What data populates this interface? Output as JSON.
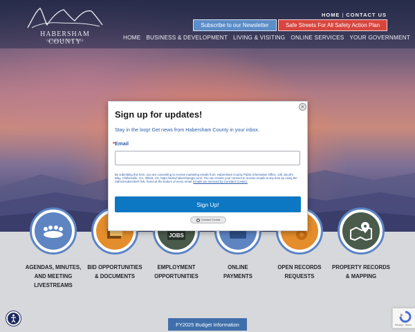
{
  "header": {
    "logo": {
      "title": "HABERSHAM COUNTY",
      "subtitle": "GEORGIA | Est. 1818"
    },
    "top_links": [
      "HOME",
      "CONTACT US"
    ],
    "newsletter_button": "Subscribe to our Newsletter",
    "safety_button": "Safe Streets For All Safety Action Plan",
    "nav": [
      "HOME",
      "BUSINESS & DEVELOPMENT",
      "LIVING & VISITING",
      "ONLINE SERVICES",
      "YOUR GOVERNMENT"
    ]
  },
  "modal": {
    "close_icon": "close-icon",
    "title": "Sign up for updates!",
    "intro": "Stay in the loop! Get news from Habersham County in your inbox.",
    "required_marker": "*",
    "email_label": "Email",
    "email_value": "",
    "consent_text": "By submitting this form, you are consenting to receive marketing emails from: Habersham County Public Information Office, 130 Jacob's Way, Clarkesville, GA, 30523, US, https://www.habershamga.com/. You can revoke your consent to receive emails at any time by using the SafeUnsubscribe® link, found at the bottom of every email.",
    "consent_link": "Emails are serviced by Constant Contact.",
    "signup_button": "Sign Up!",
    "badge_text": "Constant Contact"
  },
  "services": [
    {
      "label_1": "AGENDAS, MINUTES,",
      "label_2": "AND MEETING",
      "label_3": "LIVESTREAMS",
      "icon": "meeting-table-icon"
    },
    {
      "label_1": "BID OPPORTUNITIES",
      "label_2": "& DOCUMENTS",
      "label_3": "",
      "icon": "documents-icon"
    },
    {
      "label_1": "EMPLOYMENT",
      "label_2": "OPPORTUNITIES",
      "label_3": "",
      "icon": "jobs-icon",
      "icon_text": "JOBS"
    },
    {
      "label_1": "ONLINE",
      "label_2": "PAYMENTS",
      "label_3": "",
      "icon": "payment-card-icon"
    },
    {
      "label_1": "OPEN RECORDS",
      "label_2": "REQUESTS",
      "label_3": "",
      "icon": "gear-icon"
    },
    {
      "label_1": "PROPERTY RECORDS",
      "label_2": "& MAPPING",
      "label_3": "",
      "icon": "map-pin-icon"
    }
  ],
  "budget_button": "FY2025 Budget Information",
  "recaptcha_text": "Privacy - Terms",
  "colors": {
    "nav_bg": "#2a2f52",
    "newsletter": "#5b8dc8",
    "safety": "#d8453e",
    "signup": "#0c77c2",
    "service_blue": "#5e84c2",
    "service_orange": "#e48d2c",
    "service_dark": "#4a5b4c"
  }
}
